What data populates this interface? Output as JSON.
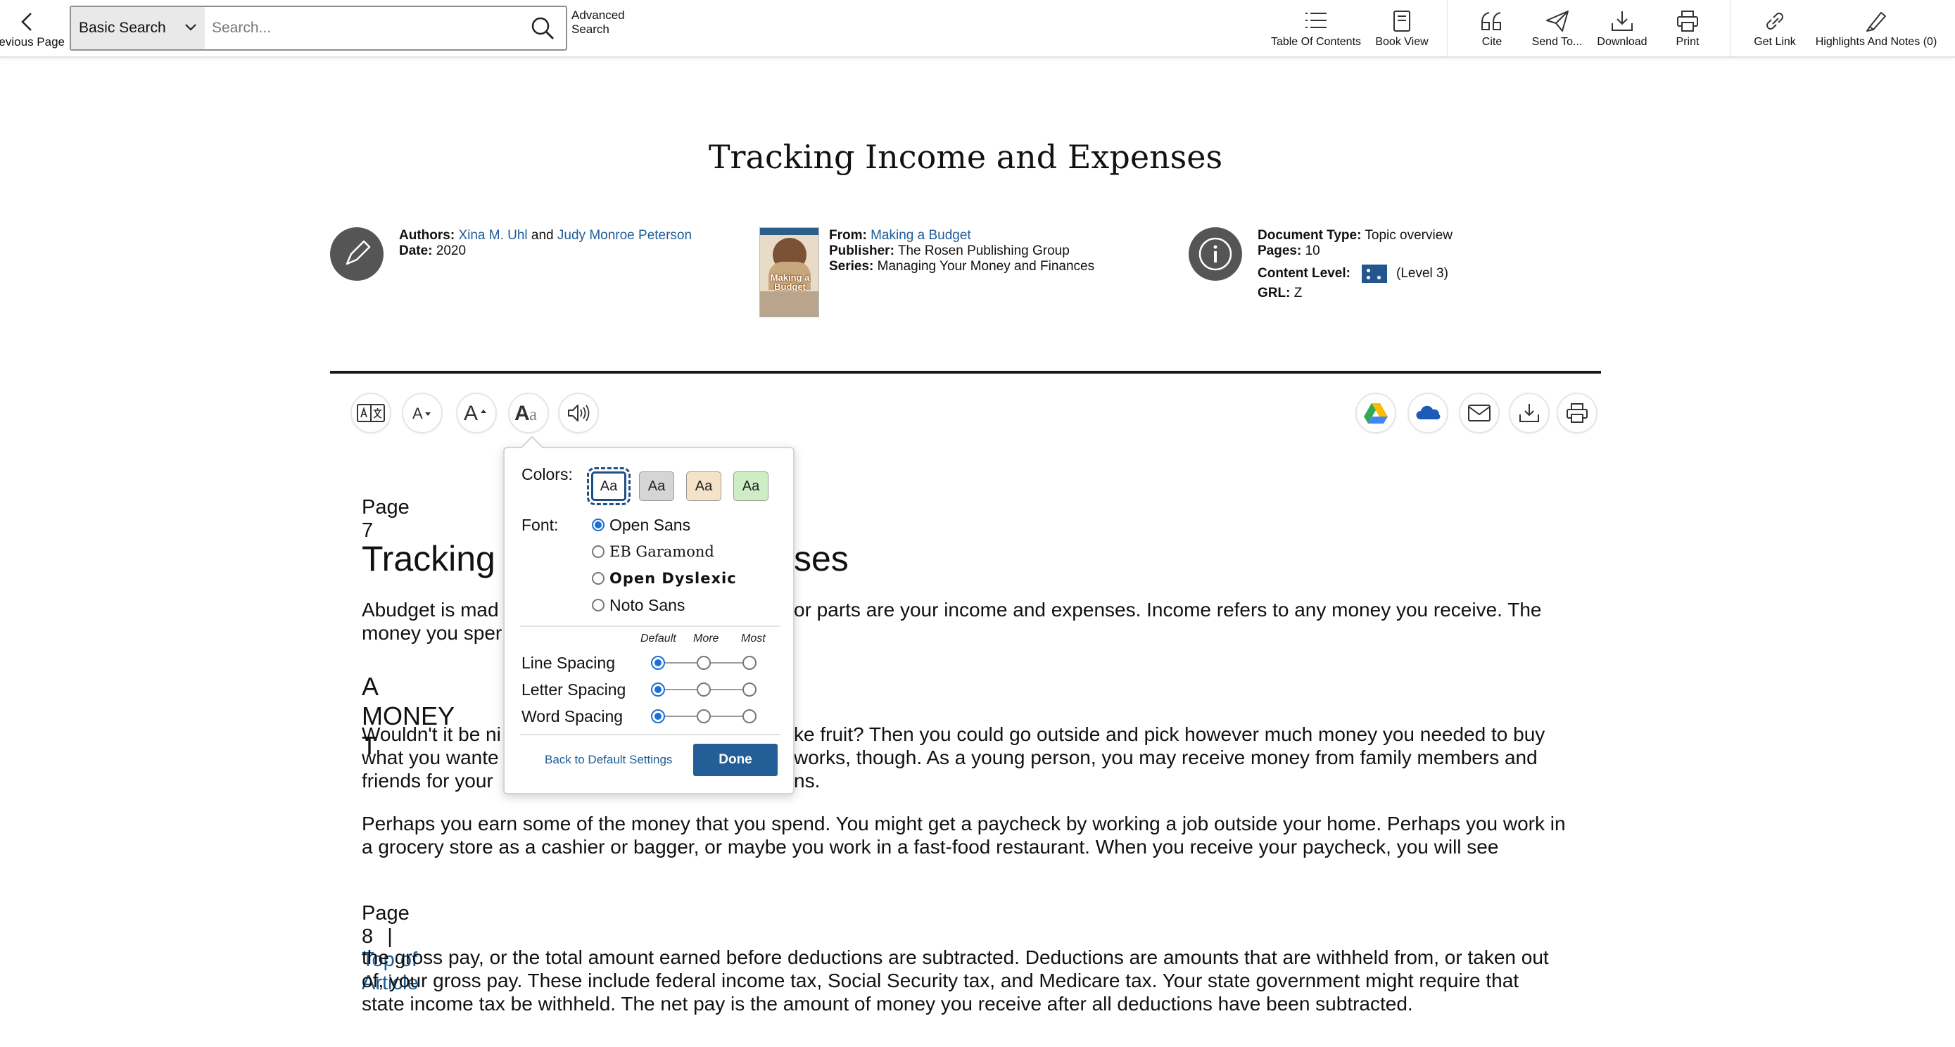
{
  "toolbar": {
    "previous_page": "Previous Page",
    "search_type": "Basic Search",
    "search_placeholder": "Search...",
    "advanced_search_line1": "Advanced",
    "advanced_search_line2": "Search",
    "items": {
      "table_of_contents": "Table Of Contents",
      "book_view": "Book View",
      "cite": "Cite",
      "send_to": "Send To...",
      "download": "Download",
      "print": "Print",
      "get_link": "Get Link",
      "highlights_notes": "Highlights And Notes (0)"
    }
  },
  "document": {
    "title": "Tracking Income and Expenses",
    "authors_label": "Authors:",
    "author1": "Xina M. Uhl",
    "author_join": "and",
    "author2": "Judy Monroe Peterson",
    "date_label": "Date:",
    "date": "2020",
    "from_label": "From:",
    "from": "Making a Budget",
    "publisher_label": "Publisher:",
    "publisher": "The Rosen Publishing Group",
    "series_label": "Series:",
    "series": "Managing Your Money and Finances",
    "book_cover_text": "Making a Budget",
    "doc_type_label": "Document Type:",
    "doc_type": "Topic overview",
    "pages_label": "Pages:",
    "pages": "10",
    "content_level_label": "Content Level:",
    "content_level": "(Level 3)",
    "grl_label": "GRL:",
    "grl": "Z"
  },
  "article": {
    "page7": "Page 7",
    "heading_visible": "Tracking",
    "heading_tail": "ses",
    "p1_line1_a": "Abudget is mad",
    "p1_line1_b": "or parts are your income and expenses. Income refers to any money you receive. The",
    "p1_line2": "money you sper",
    "subheading": "A MONEY T",
    "p2_line1_a": "Wouldn't it be ni",
    "p2_line1_b": "ke fruit? Then you could go outside and pick however much money you needed to buy",
    "p2_line2_a": "what you wante",
    "p2_line2_b": "works, though. As a young person, you may receive money from family members and",
    "p2_line3_a": "friends for your",
    "p2_line3_b": "ns.",
    "p3": "Perhaps you earn some of the money that you spend. You might get a paycheck by working a job outside your home. Perhaps you work in a grocery store as a cashier or bagger, or maybe you work in a fast-food restaurant. When you receive your paycheck, you will see",
    "page8": "Page 8",
    "page8_sep": "|",
    "top_of_article": "Top of Article",
    "p4": "the gross pay, or the total amount earned before deductions are subtracted. Deductions are amounts that are withheld from, or taken out of, your gross pay. These include federal income tax, Social Security tax, and Medicare tax. Your state government might require that state income tax be withheld. The net pay is the amount of money you receive after all deductions have been subtracted."
  },
  "popup": {
    "colors_label": "Colors:",
    "swatch_text": "Aa",
    "font_label": "Font:",
    "fonts": [
      "Open Sans",
      "EB Garamond",
      "Open Dyslexic",
      "Noto Sans"
    ],
    "selected_font": "Open Sans",
    "col_default": "Default",
    "col_more": "More",
    "col_most": "Most",
    "line_spacing": "Line Spacing",
    "letter_spacing": "Letter Spacing",
    "word_spacing": "Word Spacing",
    "reset": "Back to Default Settings",
    "done": "Done"
  },
  "colors": {
    "link": "#1d5c99",
    "accent": "#235f96",
    "radio_on": "#1d6fd1"
  }
}
